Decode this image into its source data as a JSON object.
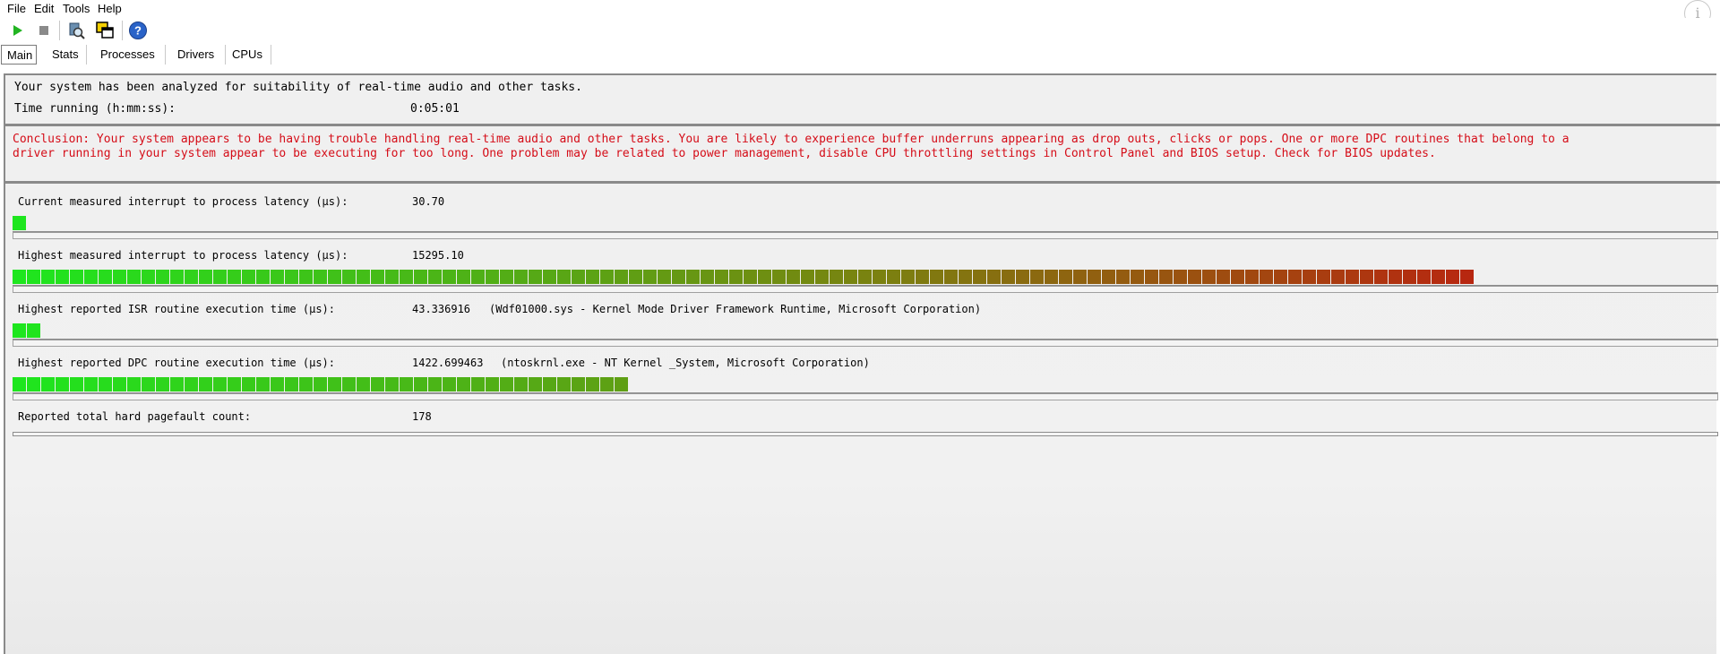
{
  "menu": {
    "file": "File",
    "edit": "Edit",
    "tools": "Tools",
    "help": "Help"
  },
  "info_icon": "i",
  "toolbar": {
    "icons": [
      "play-icon",
      "stop-icon",
      "search-driver-icon",
      "copy-windows-icon",
      "help-icon"
    ]
  },
  "tabs": [
    "Main",
    "Stats",
    "Processes",
    "Drivers",
    "CPUs"
  ],
  "summary": {
    "intro": "Your system has been analyzed for suitability of real-time audio and other tasks.",
    "time_label": "Time running (h:mm:ss):",
    "time_value": "0:05:01"
  },
  "conclusion": {
    "line1": "Conclusion: Your system appears to be having trouble handling real-time audio and other tasks. You are likely to experience buffer underruns appearing as drop outs, clicks or pops. One or more DPC routines that belong to a",
    "line2": "driver running in your system appear to be executing for too long. One problem may be related to power management, disable CPU throttling settings in Control Panel and BIOS setup. Check for BIOS updates."
  },
  "metrics": [
    {
      "label": "Current measured interrupt to process latency (µs):",
      "value": "30.70",
      "detail": "",
      "level": 0.01
    },
    {
      "label": "Highest measured interrupt to process latency (µs):",
      "value": "15295.10",
      "detail": "",
      "level": 0.855
    },
    {
      "label": "Highest reported ISR routine execution time (µs):",
      "value": "43.336916",
      "detail": "(Wdf01000.sys - Kernel Mode Driver Framework Runtime, Microsoft Corporation)",
      "level": 0.016
    },
    {
      "label": "Highest reported DPC routine execution time (µs):",
      "value": "1422.699463",
      "detail": "(ntoskrnl.exe - NT Kernel _System, Microsoft Corporation)",
      "level": 0.365
    },
    {
      "label": "Reported total hard pagefault count:",
      "value": "178",
      "detail": "",
      "level": 0
    }
  ],
  "colors": {
    "green": "#1ee61e",
    "mid": "#7a8a10",
    "red": "#d00010",
    "conclusion_text": "#d50d18"
  }
}
